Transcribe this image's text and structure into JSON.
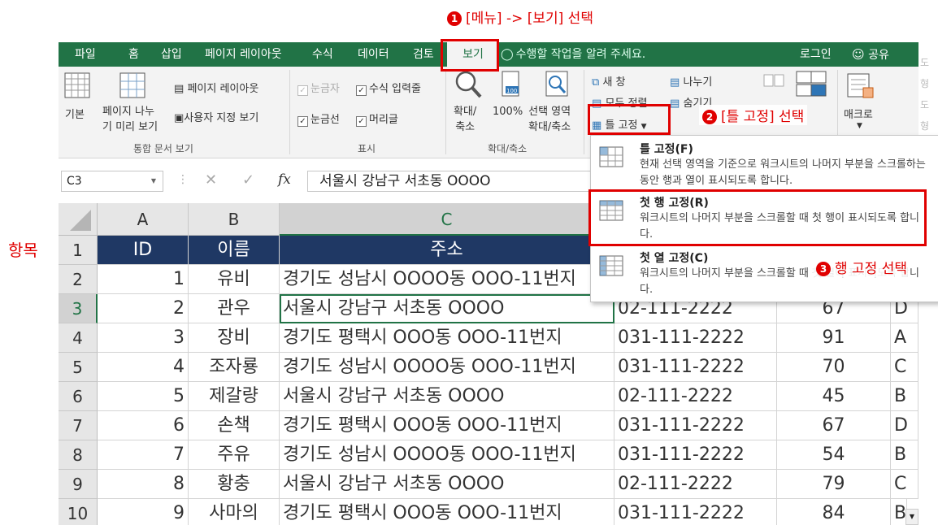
{
  "annotations": {
    "step1": {
      "num": "1",
      "text": "[메뉴] -> [보기] 선택"
    },
    "step2": {
      "num": "2",
      "text": "[틀 고정] 선택"
    },
    "step3": {
      "num": "3",
      "text": "행 고정 선택"
    },
    "row_label": "항목"
  },
  "tabs": [
    "파일",
    "홈",
    "삽입",
    "페이지 레이아웃",
    "수식",
    "데이터",
    "검토",
    "보기"
  ],
  "tellme": "수행할 작업을 알려 주세요.",
  "login": "로그인",
  "share": "공유",
  "ribbon": {
    "views": {
      "normal": "기본",
      "pagebreak_line1": "페이지 나누",
      "pagebreak_line2": "기 미리 보기",
      "page_layout": "페이지 레이아웃",
      "custom": "사용자 지정 보기",
      "group": "통합 문서 보기"
    },
    "show": {
      "ruler": "눈금자",
      "formula_bar": "수식 입력줄",
      "gridlines": "눈금선",
      "headings": "머리글",
      "group": "표시"
    },
    "zoom": {
      "zoom_line1": "확대/",
      "zoom_line2": "축소",
      "hundred": "100%",
      "sel_line1": "선택 영역",
      "sel_line2": "확대/축소",
      "group": "확대/축소"
    },
    "window": {
      "new_window": "새 창",
      "arrange_all": "모두 정렬",
      "freeze_panes": "틀 고정",
      "split": "나누기",
      "hide": "숨기기"
    },
    "macro": {
      "label": "매크로"
    }
  },
  "formula_bar": {
    "name_box": "C3",
    "fx": "fx",
    "content": "서울시 강남구 서초동 OOOO"
  },
  "columns": [
    "A",
    "B",
    "C"
  ],
  "header_row": {
    "row": "1",
    "a": "ID",
    "b": "이름",
    "c": "주소"
  },
  "rows": [
    {
      "row": "2",
      "a": "1",
      "b": "유비",
      "c": "경기도 성남시 OOOO동 OOO-11번지",
      "d": "",
      "e": "",
      "f": ""
    },
    {
      "row": "3",
      "a": "2",
      "b": "관우",
      "c": "서울시 강남구 서초동 OOOO",
      "d": "02-111-2222",
      "e": "67",
      "f": "D"
    },
    {
      "row": "4",
      "a": "3",
      "b": "장비",
      "c": "경기도 평택시 OOO동 OOO-11번지",
      "d": "031-111-2222",
      "e": "91",
      "f": "A"
    },
    {
      "row": "5",
      "a": "4",
      "b": "조자룡",
      "c": "경기도 성남시 OOOO동 OOO-11번지",
      "d": "031-111-2222",
      "e": "70",
      "f": "C"
    },
    {
      "row": "6",
      "a": "5",
      "b": "제갈량",
      "c": "서울시 강남구 서초동 OOOO",
      "d": "02-111-2222",
      "e": "45",
      "f": "B"
    },
    {
      "row": "7",
      "a": "6",
      "b": "손책",
      "c": "경기도 평택시 OOO동 OOO-11번지",
      "d": "031-111-2222",
      "e": "67",
      "f": "D"
    },
    {
      "row": "8",
      "a": "7",
      "b": "주유",
      "c": "경기도 성남시 OOOO동 OOO-11번지",
      "d": "031-111-2222",
      "e": "54",
      "f": "B"
    },
    {
      "row": "9",
      "a": "8",
      "b": "황충",
      "c": "서울시 강남구 서초동 OOOO",
      "d": "02-111-2222",
      "e": "79",
      "f": "C"
    },
    {
      "row": "10",
      "a": "9",
      "b": "사마의",
      "c": "경기도 평택시 OOO동 OOO-11번지",
      "d": "031-111-2222",
      "e": "84",
      "f": "B"
    }
  ],
  "freeze_menu": [
    {
      "title": "틀 고정(F)",
      "desc": "현재 선택 영역을 기준으로 워크시트의 나머지 부분을 스크롤하는 동안 행과 열이 표시되도록 합니다."
    },
    {
      "title": "첫 행 고정(R)",
      "desc": "워크시트의 나머지 부분을 스크롤할 때 첫 행이 표시되도록 합니다."
    },
    {
      "title": "첫 열 고정(C)",
      "desc": "워크시트의 나머지 부분을 스크롤할 때 첫 열이 표시되도록 합니다."
    }
  ],
  "right_edge_text": [
    "도형",
    "도형"
  ],
  "colors": {
    "excel_green": "#217346",
    "header_navy": "#1f3864",
    "annotation_red": "#e00000"
  }
}
